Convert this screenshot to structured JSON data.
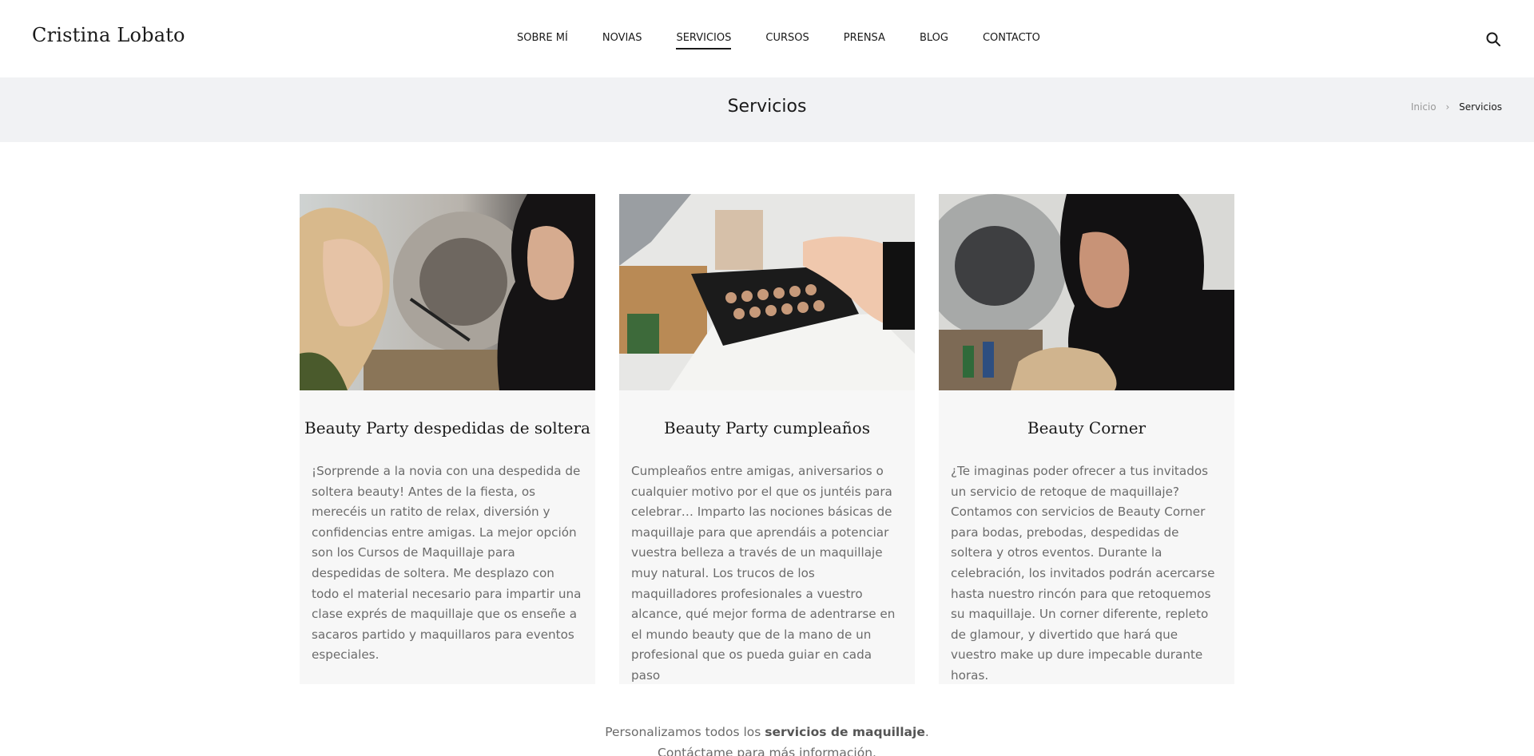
{
  "header": {
    "logo": "Cristina Lobato",
    "nav": [
      {
        "label": "SOBRE MÍ"
      },
      {
        "label": "NOVIAS"
      },
      {
        "label": "SERVICIOS",
        "active": true
      },
      {
        "label": "CURSOS"
      },
      {
        "label": "PRENSA"
      },
      {
        "label": "BLOG"
      },
      {
        "label": "CONTACTO"
      }
    ],
    "search_icon": "search-icon"
  },
  "titlebar": {
    "title": "Servicios",
    "breadcrumb": {
      "home": "Inicio",
      "separator": "›",
      "current": "Servicios"
    }
  },
  "cards": [
    {
      "title": "Beauty Party despedidas de soltera",
      "text": "¡Sorprende a la novia con una despedida de soltera beauty! Antes de la fiesta, os merecéis un ratito de relax, diversión y confidencias entre amigas. La mejor opción son los Cursos de Maquillaje para despedidas de soltera. Me desplazo con todo el material necesario para impartir una clase exprés de maquillaje que os enseñe a sacaros partido y maquillaros para eventos especiales."
    },
    {
      "title": "Beauty Party cumpleaños",
      "text": "Cumpleaños entre amigas, aniversarios o cualquier motivo por el que os juntéis para celebrar… Imparto las nociones básicas de maquillaje para que aprendáis a potenciar vuestra belleza a través de un maquillaje muy natural. Los trucos de los maquilladores profesionales a vuestro alcance, qué mejor forma de adentrarse en el mundo beauty que de la mano de un profesional que os pueda guiar en cada paso"
    },
    {
      "title": "Beauty Corner",
      "text": "¿Te imaginas poder ofrecer a tus invitados un servicio de retoque de maquillaje? Contamos con servicios de Beauty Corner para bodas, prebodas, despedidas de soltera y otros eventos. Durante la celebración, los invitados podrán acercarse hasta nuestro rincón para que retoquemos su maquillaje. Un corner diferente, repleto de glamour, y divertido que hará que vuestro make up dure impecable durante horas."
    }
  ],
  "footer": {
    "line1_prefix": "Personalizamos todos los ",
    "line1_bold": "servicios de maquillaje",
    "line1_suffix": ".",
    "line2": "Contáctame para más información."
  }
}
